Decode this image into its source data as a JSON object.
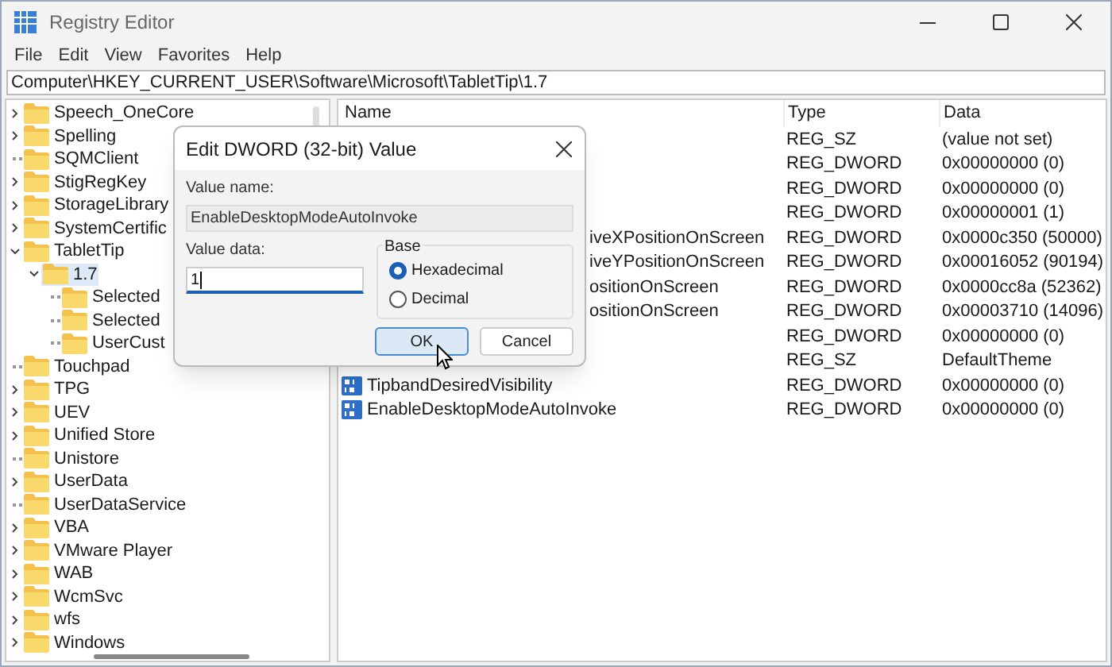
{
  "window": {
    "title": "Registry Editor"
  },
  "menu": [
    "File",
    "Edit",
    "View",
    "Favorites",
    "Help"
  ],
  "address": "Computer\\HKEY_CURRENT_USER\\Software\\Microsoft\\TabletTip\\1.7",
  "tree": [
    {
      "label": "Speech_OneCore",
      "kind": "branch",
      "expanded": false,
      "selected": false
    },
    {
      "label": "Spelling",
      "kind": "branch",
      "expanded": false,
      "selected": false
    },
    {
      "label": "SQMClient",
      "kind": "leaf",
      "selected": false
    },
    {
      "label": "StigRegKey",
      "kind": "branch",
      "expanded": false,
      "selected": false
    },
    {
      "label": "StorageLibrary",
      "kind": "branch",
      "expanded": false,
      "selected": false
    },
    {
      "label": "SystemCertific",
      "kind": "branch",
      "expanded": false,
      "selected": false
    },
    {
      "label": "TabletTip",
      "kind": "branch",
      "expanded": true,
      "selected": false,
      "children": [
        {
          "label": "1.7",
          "kind": "branch",
          "expanded": true,
          "selected": true,
          "children": [
            {
              "label": "Selected",
              "kind": "leaf",
              "selected": false
            },
            {
              "label": "Selected",
              "kind": "leaf",
              "selected": false
            },
            {
              "label": "UserCust",
              "kind": "leaf",
              "selected": false
            }
          ]
        }
      ]
    },
    {
      "label": "Touchpad",
      "kind": "leaf",
      "selected": false
    },
    {
      "label": "TPG",
      "kind": "branch",
      "expanded": false,
      "selected": false
    },
    {
      "label": "UEV",
      "kind": "branch",
      "expanded": false,
      "selected": false
    },
    {
      "label": "Unified Store",
      "kind": "branch",
      "expanded": false,
      "selected": false
    },
    {
      "label": "Unistore",
      "kind": "leaf",
      "selected": false
    },
    {
      "label": "UserData",
      "kind": "branch",
      "expanded": false,
      "selected": false
    },
    {
      "label": "UserDataService",
      "kind": "leaf",
      "selected": false
    },
    {
      "label": "VBA",
      "kind": "branch",
      "expanded": false,
      "selected": false
    },
    {
      "label": "VMware Player",
      "kind": "branch",
      "expanded": false,
      "selected": false
    },
    {
      "label": "WAB",
      "kind": "branch",
      "expanded": false,
      "selected": false
    },
    {
      "label": "WcmSvc",
      "kind": "branch",
      "expanded": false,
      "selected": false
    },
    {
      "label": "wfs",
      "kind": "branch",
      "expanded": false,
      "selected": false
    },
    {
      "label": "Windows",
      "kind": "branch",
      "expanded": false,
      "selected": false
    }
  ],
  "table": {
    "columns": [
      "Name",
      "Type",
      "Data"
    ],
    "rows": [
      {
        "type": "REG_SZ",
        "data": "(value not set)"
      },
      {
        "type": "REG_DWORD",
        "data": "0x00000000 (0)"
      },
      {
        "type": "REG_DWORD",
        "data": "0x00000000 (0)"
      },
      {
        "type": "REG_DWORD",
        "data": "0x00000001 (1)"
      },
      {
        "name": "iveXPositionOnScreen",
        "kind": "partial",
        "type": "REG_DWORD",
        "data": "0x0000c350 (50000)"
      },
      {
        "name": "iveYPositionOnScreen",
        "kind": "partial",
        "type": "REG_DWORD",
        "data": "0x00016052 (90194)"
      },
      {
        "name": "ositionOnScreen",
        "kind": "partial",
        "type": "REG_DWORD",
        "data": "0x0000cc8a (52362)"
      },
      {
        "name": "ositionOnScreen",
        "kind": "partial",
        "type": "REG_DWORD",
        "data": "0x00003710 (14096)"
      },
      {
        "type": "REG_DWORD",
        "data": "0x00000000 (0)"
      },
      {
        "type": "REG_SZ",
        "data": "DefaultTheme"
      },
      {
        "name": "TipbandDesiredVisibility",
        "kind": "full",
        "type": "REG_DWORD",
        "data": "0x00000000 (0)"
      },
      {
        "name": "EnableDesktopModeAutoInvoke",
        "kind": "full",
        "type": "REG_DWORD",
        "data": "0x00000000 (0)"
      }
    ]
  },
  "dialog": {
    "title": "Edit DWORD (32-bit) Value",
    "value_name_label": "Value name:",
    "value_name": "EnableDesktopModeAutoInvoke",
    "value_data_label": "Value data:",
    "value_data": "1",
    "base_label": "Base",
    "base_options": [
      {
        "label": "Hexadecimal",
        "selected": true
      },
      {
        "label": "Decimal",
        "selected": false
      }
    ],
    "buttons": [
      {
        "label": "OK",
        "focused": true
      },
      {
        "label": "Cancel",
        "focused": false
      }
    ]
  }
}
